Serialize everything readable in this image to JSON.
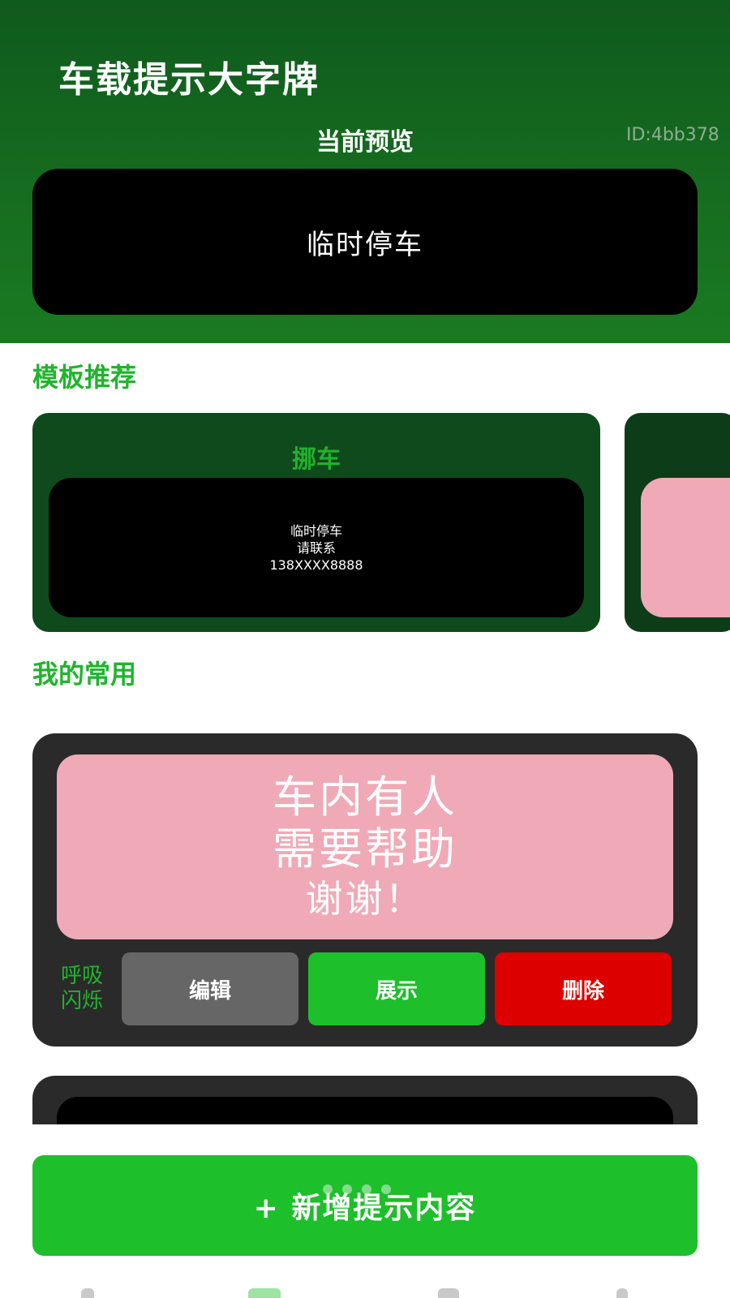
{
  "header": {
    "app_title": "车载提示大字牌",
    "preview_label": "当前预览",
    "device_id": "ID:4bb378",
    "preview_text": "临时停车"
  },
  "templates": {
    "section_title": "模板推荐",
    "cards": [
      {
        "name": "挪车",
        "lines": [
          "临时停车",
          "请联系",
          "138XXXX8888"
        ]
      }
    ]
  },
  "favorites": {
    "section_title": "我的常用",
    "items": [
      {
        "lines": [
          "车内有人",
          "需要帮助",
          "谢谢！"
        ],
        "effect_label": "呼吸闪烁",
        "edit_label": "编辑",
        "show_label": "展示",
        "delete_label": "删除"
      }
    ]
  },
  "add_button_label": "+ 新增提示内容",
  "colors": {
    "accent_green": "#1dbf2a",
    "header_green": "#15691f",
    "pink_board": "#f0a9b6",
    "delete_red": "#dc0000"
  }
}
